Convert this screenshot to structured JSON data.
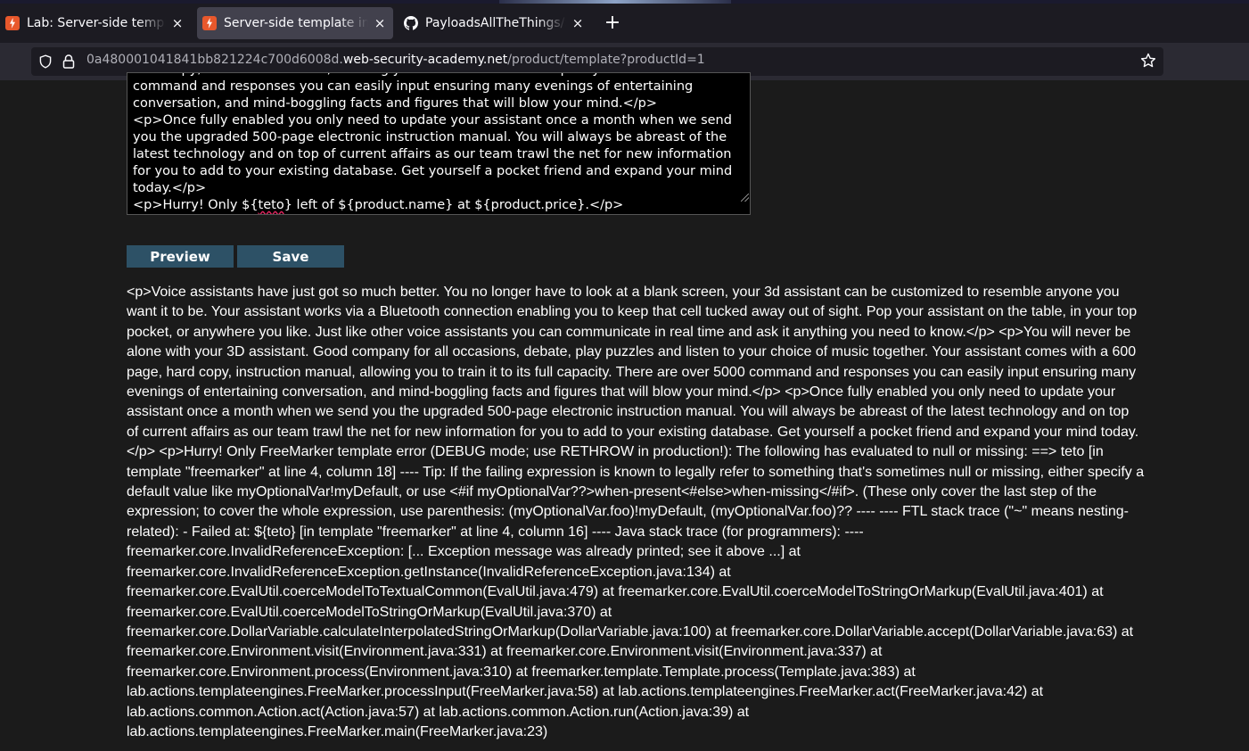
{
  "browser": {
    "tabs": [
      {
        "title": "Lab: Server-side template injection with information disclosure via user-supplied objects",
        "close": "×"
      },
      {
        "title": "Server-side template injection",
        "close": "×"
      },
      {
        "title": "PayloadsAllTheThings/Server Side Template Injection",
        "close": "×"
      }
    ],
    "new_tab": "+",
    "url": {
      "prefix": "0a480001041841bb821224c700d6008d.",
      "host": "web-security-academy.net",
      "path": "/product/template?productId=1"
    }
  },
  "editor": {
    "lines": [
      "hard copy, instruction manual, allowing you to train it to its full capacity. There are over 5000 command and responses you can easily input ensuring many evenings of entertaining conversation, and mind-boggling facts and figures that will blow your mind.</p>",
      "<p>Once fully enabled you only need to update your assistant once a month when we send you the upgraded 500-page electronic instruction manual. You will always be abreast of the latest technology and on top of current affairs as our team trawl the net for new information for you to add to your existing database. Get yourself a pocket friend and expand your mind today.</p>"
    ],
    "last_line_before": "<p>Hurry! Only ${",
    "last_line_spell": "teto",
    "last_line_after": "} left of ${product.name} at ${product.price}.</p>"
  },
  "buttons": {
    "preview": "Preview",
    "save": "Save"
  },
  "preview_output": "<p>Voice assistants have just got so much better. You no longer have to look at a blank screen, your 3d assistant can be customized to resemble anyone you want it to be. Your assistant works via a Bluetooth connection enabling you to keep that cell tucked away out of sight. Pop your assistant on the table, in your top pocket, or anywhere you like. Just like other voice assistants you can communicate in real time and ask it anything you need to know.</p> <p>You will never be alone with your 3D assistant. Good company for all occasions, debate, play puzzles and listen to your choice of music together. Your assistant comes with a 600 page, hard copy, instruction manual, allowing you to train it to its full capacity. There are over 5000 command and responses you can easily input ensuring many evenings of entertaining conversation, and mind-boggling facts and figures that will blow your mind.</p> <p>Once fully enabled you only need to update your assistant once a month when we send you the upgraded 500-page electronic instruction manual. You will always be abreast of the latest technology and on top of current affairs as our team trawl the net for new information for you to add to your existing database. Get yourself a pocket friend and expand your mind today.</p> <p>Hurry! Only FreeMarker template error (DEBUG mode; use RETHROW in production!): The following has evaluated to null or missing: ==> teto [in template \"freemarker\" at line 4, column 18] ---- Tip: If the failing expression is known to legally refer to something that's sometimes null or missing, either specify a default value like myOptionalVar!myDefault, or use <#if myOptionalVar??>when-present<#else>when-missing</#if>. (These only cover the last step of the expression; to cover the whole expression, use parenthesis: (myOptionalVar.foo)!myDefault, (myOptionalVar.foo)?? ---- ---- FTL stack trace (\"~\" means nesting-related): - Failed at: ${teto} [in template \"freemarker\" at line 4, column 16] ---- Java stack trace (for programmers): ---- freemarker.core.InvalidReferenceException: [... Exception message was already printed; see it above ...] at freemarker.core.InvalidReferenceException.getInstance(InvalidReferenceException.java:134) at freemarker.core.EvalUtil.coerceModelToTextualCommon(EvalUtil.java:479) at freemarker.core.EvalUtil.coerceModelToStringOrMarkup(EvalUtil.java:401) at freemarker.core.EvalUtil.coerceModelToStringOrMarkup(EvalUtil.java:370) at freemarker.core.DollarVariable.calculateInterpolatedStringOrMarkup(DollarVariable.java:100) at freemarker.core.DollarVariable.accept(DollarVariable.java:63) at freemarker.core.Environment.visit(Environment.java:331) at freemarker.core.Environment.visit(Environment.java:337) at freemarker.core.Environment.process(Environment.java:310) at freemarker.template.Template.process(Template.java:383) at lab.actions.templateengines.FreeMarker.processInput(FreeMarker.java:58) at lab.actions.templateengines.FreeMarker.act(FreeMarker.java:42) at lab.actions.common.Action.act(Action.java:57) at lab.actions.common.Action.run(Action.java:39) at lab.actions.templateengines.FreeMarker.main(FreeMarker.java:23)"
}
